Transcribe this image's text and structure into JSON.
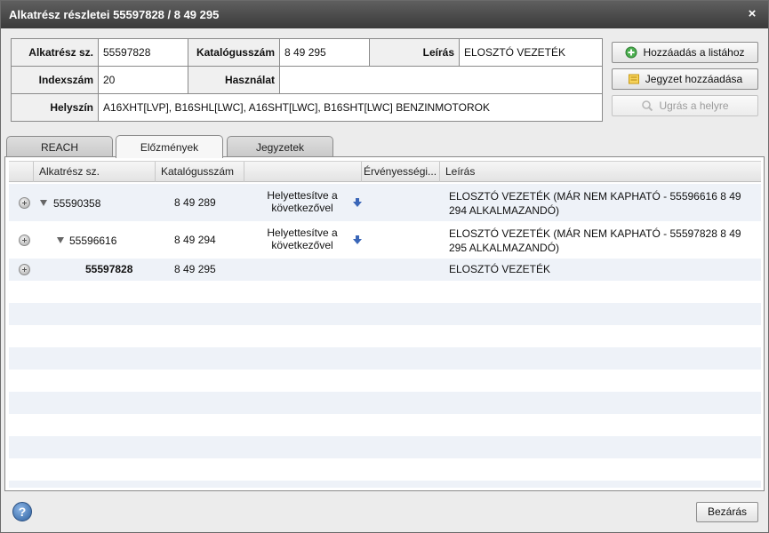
{
  "window": {
    "title": "Alkatrész részletei 55597828 / 8 49 295",
    "close_glyph": "×"
  },
  "info": {
    "part_no_label": "Alkatrész sz.",
    "part_no_value": "55597828",
    "catalog_label": "Katalógusszám",
    "catalog_value": "8 49 295",
    "desc_label": "Leírás",
    "desc_value": "ELOSZTÓ VEZETÉK",
    "index_label": "Indexszám",
    "index_value": "20",
    "usage_label": "Használat",
    "usage_value": "",
    "location_label": "Helyszín",
    "location_value": "A16XHT[LVP], B16SHL[LWC], A16SHT[LWC], B16SHT[LWC] BENZINMOTOROK"
  },
  "buttons": {
    "add_to_list": "Hozzáadás a listához",
    "add_note": "Jegyzet hozzáadása",
    "goto_location": "Ugrás a helyre"
  },
  "tabs": [
    "REACH",
    "Előzmények",
    "Jegyzetek"
  ],
  "active_tab": "Előzmények",
  "grid": {
    "headers": [
      "Alkatrész sz.",
      "Katalógusszám",
      "",
      "Érvényességi...",
      "Leírás"
    ],
    "rows": [
      {
        "part": "55590358",
        "catalog": "8 49 289",
        "action": "Helyettesítve a következővel",
        "desc": "ELOSZTÓ VEZETÉK (MÁR NEM KAPHATÓ - 55596616  8 49 294 ALKALMAZANDÓ)"
      },
      {
        "part": "55596616",
        "catalog": "8 49 294",
        "action": "Helyettesítve a következővel",
        "desc": "ELOSZTÓ VEZETÉK (MÁR NEM KAPHATÓ - 55597828  8 49 295 ALKALMAZANDÓ)"
      },
      {
        "part": "55597828",
        "catalog": "8 49 295",
        "action": "",
        "desc": "ELOSZTÓ VEZETÉK"
      }
    ]
  },
  "footer": {
    "help_glyph": "?",
    "close_label": "Bezárás"
  },
  "colors": {
    "titlebar": "#4a4a4a",
    "row_alt": "#eef2f8",
    "accent_blue": "#3a66b8"
  }
}
